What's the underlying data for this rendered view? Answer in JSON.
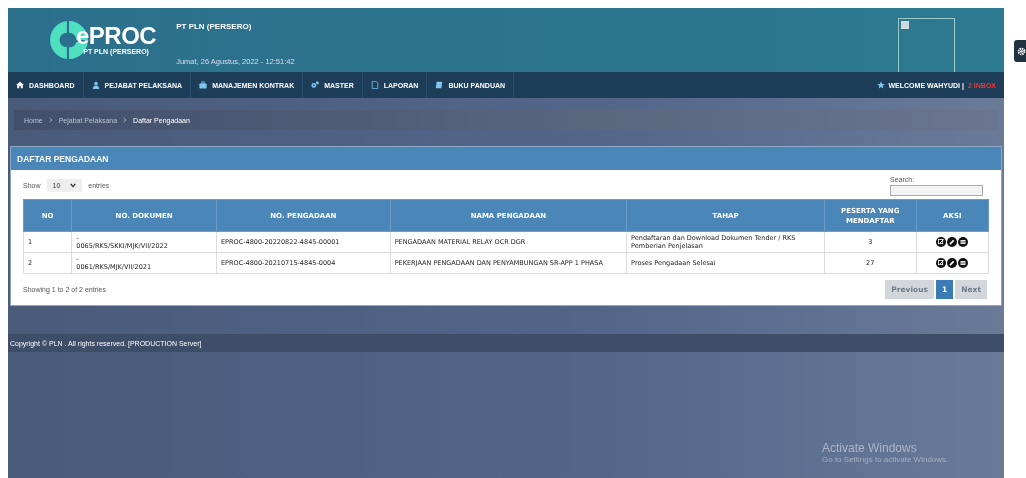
{
  "header": {
    "logo_text": "ePROC",
    "logo_subtext": "PT PLN (PERSERO)",
    "company": "PT PLN (PERSERO)",
    "datetime": "Jumat, 26 Agustus, 2022 - 12:51:42"
  },
  "nav": {
    "items": [
      {
        "label": "DASHBOARD"
      },
      {
        "label": "PEJABAT PELAKSANA"
      },
      {
        "label": "MANAJEMEN KONTRAK"
      },
      {
        "label": "MASTER"
      },
      {
        "label": "LAPORAN"
      },
      {
        "label": "BUKU PANDUAN"
      }
    ],
    "welcome": "WELCOME WAHYUDI |",
    "inbox": "2 INBOX"
  },
  "breadcrumb": [
    "Home",
    "Pejabat Pelaksana",
    "Daftar Pengadaan"
  ],
  "panel": {
    "title": "DAFTAR PENGADAAN",
    "show_label": "Show",
    "entries_value": "10",
    "entries_label": "entries",
    "search_label": "Search:",
    "table": {
      "columns": [
        "NO",
        "NO. DOKUMEN",
        "NO. PENGADAAN",
        "NAMA PENGADAAN",
        "TAHAP",
        "PESERTA YANG MENDAFTAR",
        "AKSI"
      ],
      "rows": [
        {
          "no": "1",
          "dokumen_prefix": "-",
          "dokumen": "0065/RKS/SKKI/MJK/VII/2022",
          "pengadaan": "EPROC-4800-20220822-4845-00001",
          "nama": "PENGADAAN MATERIAL RELAY OCR DGR",
          "tahap": [
            "Pendaftaran dan Download Dokumen Tender / RKS",
            "Pemberian Penjelasan"
          ],
          "peserta": "3"
        },
        {
          "no": "2",
          "dokumen_prefix": "-",
          "dokumen": "0061/RKS/MJK/VII/2021",
          "pengadaan": "EPROC-4800-20210715-4845-0004",
          "nama": "PEKERJAAN PENGADAAN DAN PENYAMBUNGAN SR-APP 1 PHASA",
          "tahap": [
            "Proses Pengadaan Selesai"
          ],
          "peserta": "27"
        }
      ]
    },
    "info": "Showing 1 to 2 of 2 entries",
    "pagination": [
      {
        "label": "Previous",
        "disabled": true,
        "selected": false
      },
      {
        "label": "1",
        "disabled": false,
        "selected": true
      },
      {
        "label": "Next",
        "disabled": true,
        "selected": false
      }
    ]
  },
  "footer": "Copyright © PLN . All rights reserved. [PRODUCTION Server]",
  "os_notice": {
    "title": "Activate Windows",
    "subtitle": "Go to Settings to activate Windows."
  }
}
